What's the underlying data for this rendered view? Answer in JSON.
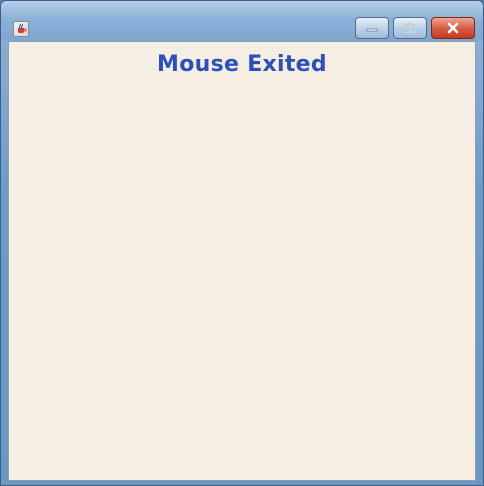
{
  "window": {
    "title": "",
    "icon": "java-cup-icon",
    "controls": {
      "minimize": "minimize-icon",
      "maximize": "maximize-icon",
      "close": "close-icon"
    }
  },
  "content": {
    "message": "Mouse Exited",
    "message_color": "#2b4fbf",
    "background_color": "#f5eee3"
  }
}
